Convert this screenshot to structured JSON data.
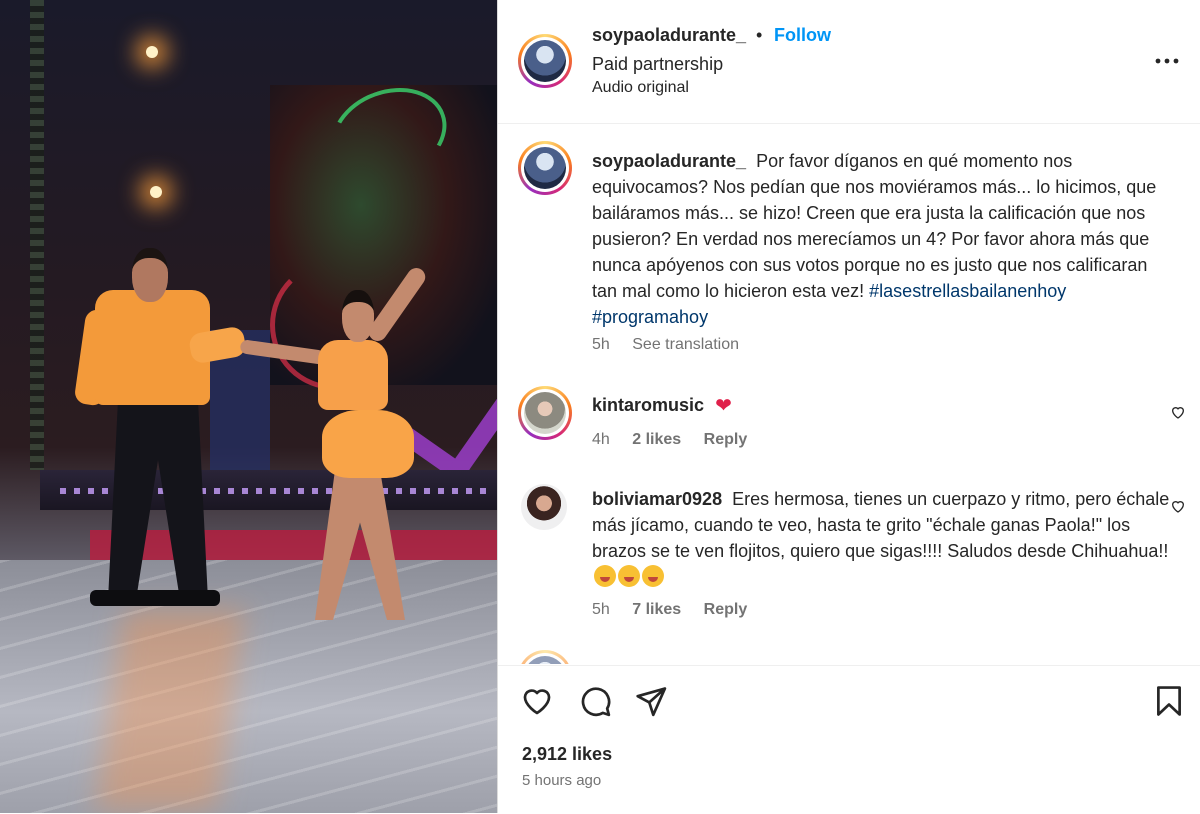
{
  "post": {
    "username": "soypaoladurante_",
    "separator": "•",
    "follow_label": "Follow",
    "paid_partnership": "Paid partnership",
    "audio": "Audio original"
  },
  "caption": {
    "username": "soypaoladurante_",
    "text": "Por favor díganos en qué momento nos equivocamos? Nos pedían que nos moviéramos más... lo hicimos, que bailáramos más... se hizo! Creen que era justa la calificación que nos pusieron? En verdad nos merecíamos un 4? Por favor ahora más que nunca apóyenos con sus votos porque no es justo que nos calificaran tan mal como lo hicieron esta vez!",
    "hashtag1": "#lasestrellasbailanenhoy",
    "hashtag2": "#programahoy",
    "time": "5h",
    "see_translation": "See translation"
  },
  "comments": [
    {
      "username": "kintaromusic",
      "text": "",
      "emoji": "red-heart",
      "time": "4h",
      "likes": "2 likes",
      "reply": "Reply"
    },
    {
      "username": "boliviamar0928",
      "text": "Eres hermosa, tienes un cuerpazo y ritmo, pero échale más jícamo, cuando te veo, hasta te grito \"échale ganas Paola!\" los brazos se te ven flojitos, quiero que sigas!!!! Saludos desde Chihuahua!!",
      "emoji": "face-emoji x3",
      "time": "5h",
      "likes": "7 likes",
      "reply": "Reply"
    }
  ],
  "footer": {
    "likes": "2,912 likes",
    "time": "5 hours ago"
  },
  "colors": {
    "follow_blue": "#0095f6",
    "hashtag_blue": "#00376b",
    "muted": "#737373",
    "text": "#262626",
    "heart_red": "#e0204a"
  }
}
